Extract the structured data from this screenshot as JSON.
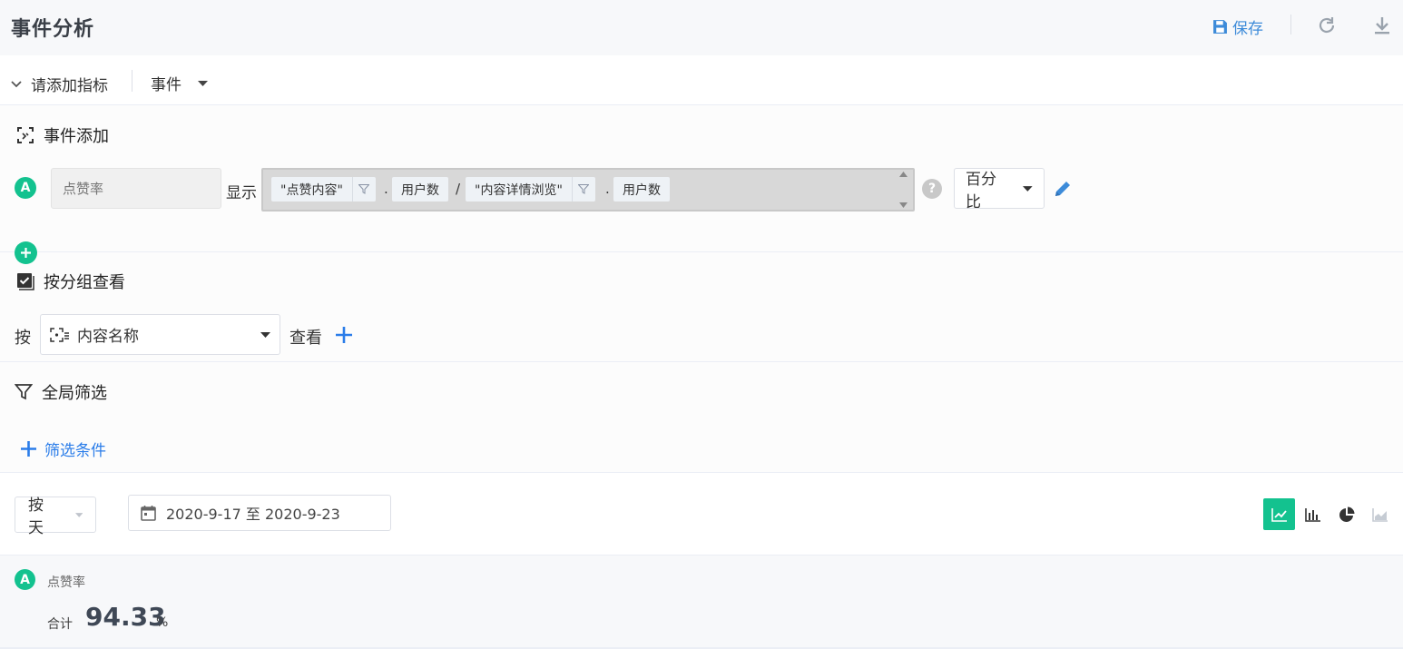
{
  "header": {
    "title": "事件分析",
    "save_label": "保存"
  },
  "metric_bar": {
    "add_metric_label": "请添加指标",
    "type_select": "事件"
  },
  "event_section": {
    "title": "事件添加",
    "events": [
      {
        "badge": "A",
        "name_placeholder": "点赞率",
        "display_label": "显示",
        "formula": {
          "numerator_event": "\"点赞内容\"",
          "dot1": ".",
          "numerator_measure": "用户数",
          "operator": "/",
          "denominator_event": "\"内容详情浏览\"",
          "dot2": ".",
          "denominator_measure": "用户数"
        },
        "help": "?",
        "unit": "百分比"
      }
    ]
  },
  "group_section": {
    "title": "按分组查看",
    "by_label": "按",
    "group_value": "内容名称",
    "view_label": "查看"
  },
  "filter_section": {
    "title": "全局筛选",
    "add_condition_label": "筛选条件"
  },
  "controls": {
    "granularity": "按天",
    "date_range": "2020-9-17 至 2020-9-23",
    "chart_types": [
      "line-chart",
      "bar-chart",
      "pie-chart",
      "area-chart"
    ],
    "active_chart_type": "line-chart"
  },
  "result": {
    "badge": "A",
    "metric_name": "点赞率",
    "total_label": "合计",
    "total_value": "94.33",
    "total_unit": "%"
  },
  "colors": {
    "accent_green": "#13c28f",
    "link_blue": "#2b7de9",
    "save_blue": "#3d8bd9"
  }
}
